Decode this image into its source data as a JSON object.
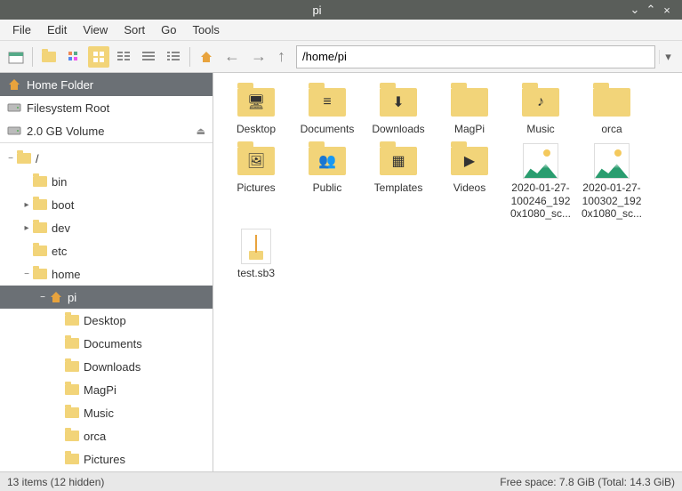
{
  "window": {
    "title": "pi"
  },
  "menubar": [
    "File",
    "Edit",
    "View",
    "Sort",
    "Go",
    "Tools"
  ],
  "path": "/home/pi",
  "places": [
    {
      "name": "Home Folder",
      "icon": "home",
      "active": true
    },
    {
      "name": "Filesystem Root",
      "icon": "drive"
    },
    {
      "name": "2.0 GB Volume",
      "icon": "drive",
      "eject": true
    }
  ],
  "tree": [
    {
      "label": "/",
      "depth": 0,
      "exp": "−",
      "icon": "folder"
    },
    {
      "label": "bin",
      "depth": 1,
      "exp": "",
      "icon": "folder"
    },
    {
      "label": "boot",
      "depth": 1,
      "exp": "▸",
      "icon": "folder"
    },
    {
      "label": "dev",
      "depth": 1,
      "exp": "▸",
      "icon": "folder"
    },
    {
      "label": "etc",
      "depth": 1,
      "exp": "",
      "icon": "folder"
    },
    {
      "label": "home",
      "depth": 1,
      "exp": "−",
      "icon": "folder"
    },
    {
      "label": "pi",
      "depth": 2,
      "exp": "−",
      "icon": "home",
      "sel": true
    },
    {
      "label": "Desktop",
      "depth": 3,
      "exp": "",
      "icon": "folder"
    },
    {
      "label": "Documents",
      "depth": 3,
      "exp": "",
      "icon": "folder"
    },
    {
      "label": "Downloads",
      "depth": 3,
      "exp": "",
      "icon": "folder"
    },
    {
      "label": "MagPi",
      "depth": 3,
      "exp": "",
      "icon": "folder"
    },
    {
      "label": "Music",
      "depth": 3,
      "exp": "",
      "icon": "folder"
    },
    {
      "label": "orca",
      "depth": 3,
      "exp": "",
      "icon": "folder"
    },
    {
      "label": "Pictures",
      "depth": 3,
      "exp": "",
      "icon": "folder"
    }
  ],
  "items": [
    {
      "label": "Desktop",
      "type": "folder",
      "overlay": "🖥"
    },
    {
      "label": "Documents",
      "type": "folder",
      "overlay": "≡"
    },
    {
      "label": "Downloads",
      "type": "folder",
      "overlay": "⬇"
    },
    {
      "label": "MagPi",
      "type": "folder",
      "overlay": ""
    },
    {
      "label": "Music",
      "type": "folder",
      "overlay": "♪"
    },
    {
      "label": "orca",
      "type": "folder",
      "overlay": ""
    },
    {
      "label": "Pictures",
      "type": "folder",
      "overlay": "🖼"
    },
    {
      "label": "Public",
      "type": "folder",
      "overlay": "👥"
    },
    {
      "label": "Templates",
      "type": "folder",
      "overlay": "▦"
    },
    {
      "label": "Videos",
      "type": "folder",
      "overlay": "▶"
    },
    {
      "label": "2020-01-27-100246_1920x1080_sc...",
      "type": "image"
    },
    {
      "label": "2020-01-27-100302_1920x1080_sc...",
      "type": "image"
    },
    {
      "label": "test.sb3",
      "type": "archive"
    }
  ],
  "status": {
    "left": "13 items (12 hidden)",
    "right": "Free space: 7.8 GiB (Total: 14.3 GiB)"
  }
}
